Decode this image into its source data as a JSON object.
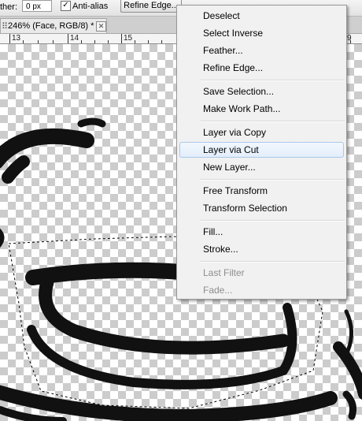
{
  "options_bar": {
    "feather_label": "ther:",
    "feather_value": "0 px",
    "antialias_checked": true,
    "antialias_label": "Anti-alias",
    "refine_edge_label": "Refine Edge..."
  },
  "document_tab": {
    "title": "246% (Face, RGB/8) *",
    "close_glyph": "✕"
  },
  "ruler": {
    "labels": [
      "13",
      "14",
      "15",
      "9"
    ]
  },
  "context_menu": {
    "items": [
      {
        "label": "Deselect",
        "enabled": true
      },
      {
        "label": "Select Inverse",
        "enabled": true
      },
      {
        "label": "Feather...",
        "enabled": true
      },
      {
        "label": "Refine Edge...",
        "enabled": true
      },
      {
        "label": "Save Selection...",
        "enabled": true
      },
      {
        "label": "Make Work Path...",
        "enabled": true
      },
      {
        "label": "Layer via Copy",
        "enabled": true
      },
      {
        "label": "Layer via Cut",
        "enabled": true,
        "highlighted": true
      },
      {
        "label": "New Layer...",
        "enabled": true
      },
      {
        "label": "Free Transform",
        "enabled": true
      },
      {
        "label": "Transform Selection",
        "enabled": true
      },
      {
        "label": "Fill...",
        "enabled": true
      },
      {
        "label": "Stroke...",
        "enabled": true
      },
      {
        "label": "Last Filter",
        "enabled": false
      },
      {
        "label": "Fade...",
        "enabled": false
      }
    ]
  },
  "colors": {
    "checker_dark": "#cccccc",
    "menu_background": "#f1f1f1",
    "menu_highlight_border": "#a8c8ec",
    "disabled_text": "#8d8d8d"
  }
}
